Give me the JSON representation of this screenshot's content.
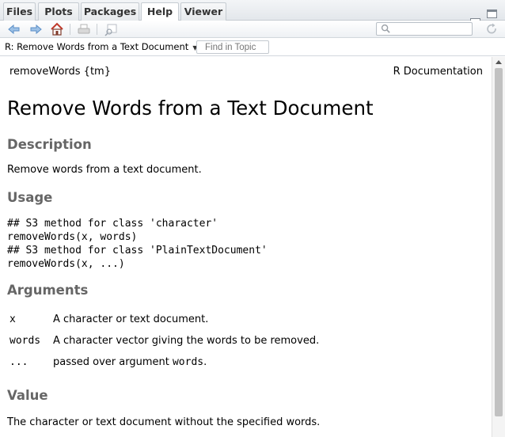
{
  "tabs": [
    {
      "label": "Files",
      "active": false
    },
    {
      "label": "Plots",
      "active": false
    },
    {
      "label": "Packages",
      "active": false
    },
    {
      "label": "Help",
      "active": true
    },
    {
      "label": "Viewer",
      "active": false
    }
  ],
  "toolbar": {
    "icons": [
      "back-arrow-icon",
      "forward-arrow-icon",
      "home-icon",
      "print-icon",
      "open-in-window-icon",
      "refresh-icon"
    ],
    "search_placeholder": ""
  },
  "topicbar": {
    "selected_topic": "R: Remove Words from a Text Document",
    "find_placeholder": "Find in Topic"
  },
  "doc": {
    "header_left": "removeWords {tm}",
    "header_right": "R Documentation",
    "title": "Remove Words from a Text Document",
    "description_heading": "Description",
    "description_text": "Remove words from a text document.",
    "usage_heading": "Usage",
    "usage_code": [
      "## S3 method for class 'character'",
      "removeWords(x, words)",
      "## S3 method for class 'PlainTextDocument'",
      "removeWords(x, ...)"
    ],
    "arguments_heading": "Arguments",
    "arguments": [
      {
        "name": "x",
        "desc": "A character or text document."
      },
      {
        "name": "words",
        "desc": "A character vector giving the words to be removed."
      },
      {
        "name": "...",
        "desc_prefix": "passed over argument ",
        "desc_code": "words",
        "desc_suffix": "."
      }
    ],
    "value_heading": "Value",
    "value_text": "The character or text document without the specified words."
  }
}
